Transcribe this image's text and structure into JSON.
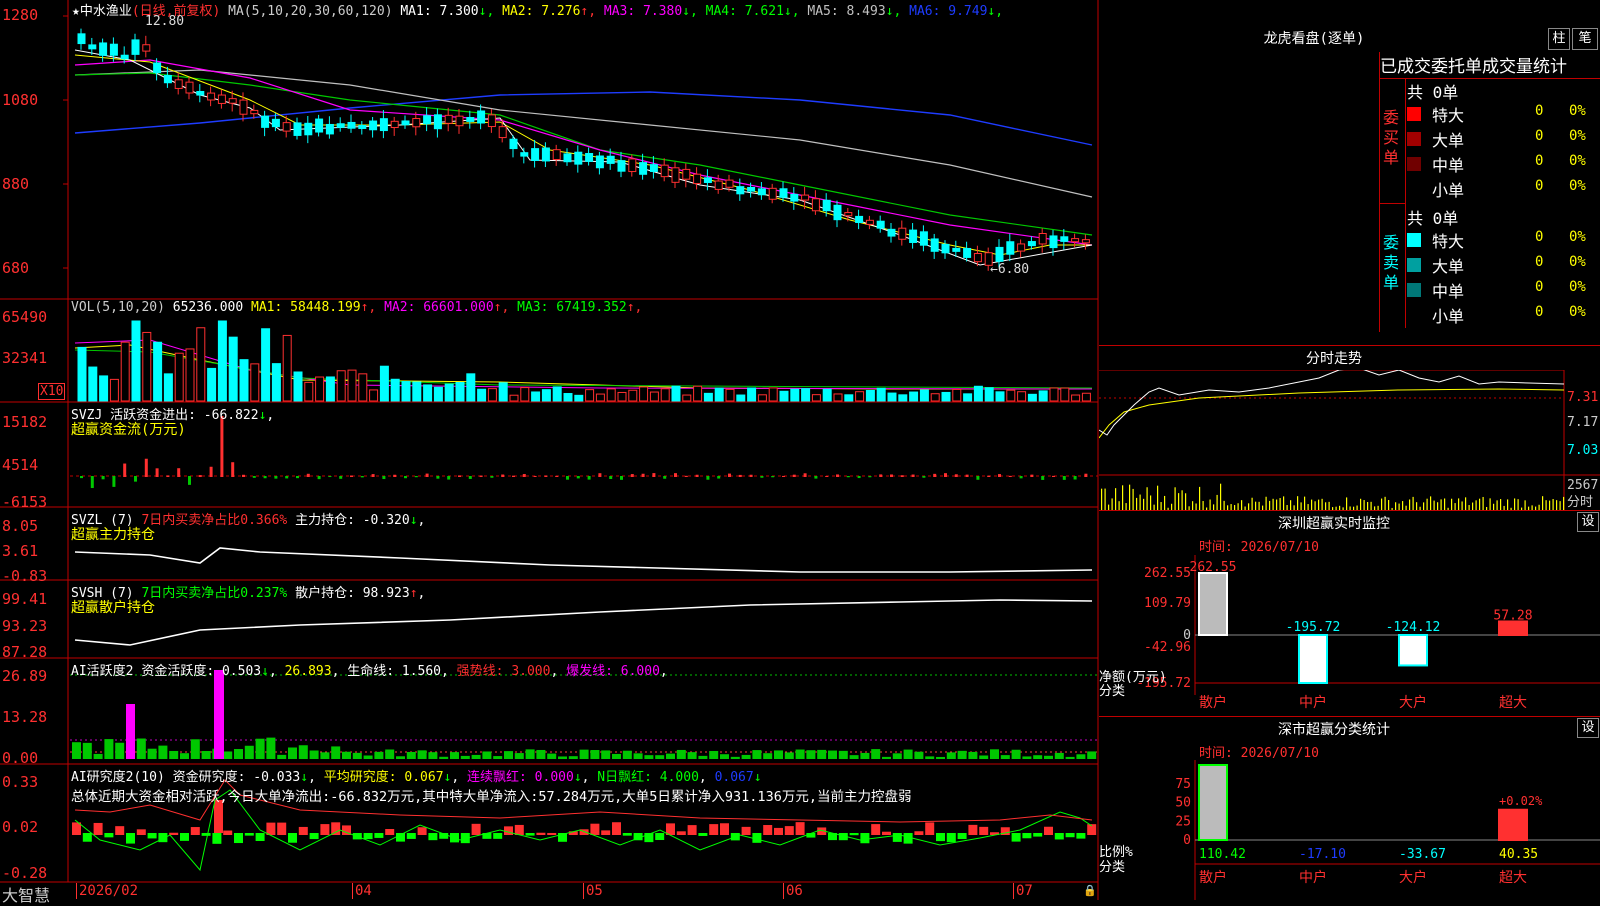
{
  "main": {
    "star": "★",
    "stock": "中水渔业",
    "period": "(日线,前复权)",
    "ma_formula": "MA(5,10,20,30,60,120)",
    "ma_values": [
      {
        "label": "MA1:",
        "value": "7.300",
        "arrow": "↓",
        "color": "#ffffff"
      },
      {
        "label": "MA2:",
        "value": "7.276",
        "arrow": "↑",
        "color": "#ffff00"
      },
      {
        "label": "MA3:",
        "value": "7.380",
        "arrow": "↓",
        "color": "#ff00ff"
      },
      {
        "label": "MA4:",
        "value": "7.621",
        "arrow": "↓",
        "color": "#00ff00"
      },
      {
        "label": "MA5:",
        "value": "8.493",
        "arrow": "↓",
        "color": "#c0c0c0"
      },
      {
        "label": "MA6:",
        "value": "9.749",
        "arrow": "↓",
        "color": "#1e3cff"
      }
    ],
    "y_ticks": [
      "1280",
      "1080",
      "880",
      "680"
    ],
    "high_label": "12.80",
    "low_label": "←6.80"
  },
  "vol": {
    "formula": "VOL(5,10,20)",
    "value": "65236.000",
    "ma_values": [
      {
        "label": "MA1:",
        "value": "58448.199",
        "arrow": "↑",
        "color": "#ffff00"
      },
      {
        "label": "MA2:",
        "value": "66601.000",
        "arrow": "↑",
        "color": "#ff00ff"
      },
      {
        "label": "MA3:",
        "value": "67419.352",
        "arrow": "↑",
        "color": "#00ff00"
      }
    ],
    "y_ticks": [
      "65490",
      "32341"
    ],
    "unit": "X10"
  },
  "svzj": {
    "title": "SVZJ",
    "label": "活跃资金进出:",
    "value": "-66.822",
    "arrow": "↓",
    "subtitle": "超赢资金流(万元)",
    "y_ticks": [
      "15182",
      "4514",
      "-6153"
    ]
  },
  "svzl": {
    "title": "SVZL (7)",
    "desc": "7日内买卖净占比0.366%",
    "label": "主力持仓:",
    "value": "-0.320",
    "arrow": "↓",
    "subtitle": "超赢主力持仓",
    "y_ticks": [
      "8.05",
      "3.61",
      "-0.83"
    ]
  },
  "svsh": {
    "title": "SVSH (7)",
    "desc": "7日内买卖净占比0.237%",
    "label": "散户持仓:",
    "value": "98.923",
    "arrow": "↑",
    "subtitle": "超赢散户持仓",
    "y_ticks": [
      "99.41",
      "93.23",
      "87.28"
    ]
  },
  "ai_active": {
    "title": "AI活跃度2",
    "label": "资金活跃度:",
    "value": "0.503",
    "arrow": "↓",
    "v2": "26.893",
    "life": "生命线: 1.560",
    "strong": "强势线: 3.000",
    "burst": "爆发线: 6.000",
    "y_ticks": [
      "26.89",
      "13.28",
      "0.00"
    ]
  },
  "ai_research": {
    "title": "AI研究度2(10)",
    "label": "资金研究度:",
    "value": "-0.033",
    "avg": "平均研究度: 0.067",
    "cont": "连续飘红: 0.000",
    "nday": "N日飘红: 4.000",
    "last": "0.067",
    "summary": "总体近期大资金相对活跃,今日大单净流出:-66.832万元,其中特大单净流入:57.284万元,大单5日累计净入931.136万元,当前主力控盘弱",
    "y_ticks": [
      "0.33",
      "0.02",
      "-0.28"
    ]
  },
  "dates": [
    "2026/02",
    "04",
    "05",
    "06",
    "07"
  ],
  "brand": "大智慧",
  "right": {
    "lhb_title": "龙虎看盘(逐单)",
    "btn_zhu": "柱",
    "btn_bi": "笔",
    "tabs": [
      "已成交",
      "委托单",
      "成交量统计"
    ],
    "buy": {
      "total": "共 0单",
      "side": "委买单",
      "rows": [
        {
          "name": "特大",
          "count": "0",
          "pct": "0%",
          "color": "#ff0000"
        },
        {
          "name": "大单",
          "count": "0",
          "pct": "0%",
          "color": "#a00000"
        },
        {
          "name": "中单",
          "count": "0",
          "pct": "0%",
          "color": "#700000"
        },
        {
          "name": "小单",
          "count": "0",
          "pct": "0%",
          "color": ""
        }
      ]
    },
    "sell": {
      "total": "共 0单",
      "side": "委卖单",
      "rows": [
        {
          "name": "特大",
          "count": "0",
          "pct": "0%",
          "color": "#00ffff"
        },
        {
          "name": "大单",
          "count": "0",
          "pct": "0%",
          "color": "#00a0a0"
        },
        {
          "name": "中单",
          "count": "0",
          "pct": "0%",
          "color": "#007878"
        },
        {
          "name": "小单",
          "count": "0",
          "pct": "0%",
          "color": ""
        }
      ]
    },
    "intraday": {
      "title": "分时走势",
      "y_ticks": [
        "7.31",
        "7.17",
        "7.03"
      ],
      "vol_tick": "2567",
      "vol_label": "分时"
    },
    "sz_monitor": {
      "title": "深圳超赢实时监控",
      "set": "设",
      "time": "时间: 2026/07/10",
      "y_ticks": [
        "262.55",
        "109.79",
        "0",
        "-42.96",
        "-195.72"
      ],
      "axis_label": "净额(万元)",
      "cat_label": "分类"
    },
    "sz_class": {
      "title": "深市超赢分类统计",
      "set": "设",
      "time": "时间: 2026/07/10",
      "y_ticks": [
        "75",
        "50",
        "25",
        "0"
      ],
      "axis_label": "比例%",
      "cat_label": "分类",
      "pct_label": "+0.02%"
    }
  },
  "chart_data": [
    {
      "type": "bar",
      "title": "深圳超赢实时监控",
      "categories": [
        "散户",
        "中户",
        "大户",
        "超大"
      ],
      "values": [
        262.55,
        -195.72,
        -124.12,
        57.28
      ],
      "ylim": [
        -195.72,
        262.55
      ],
      "ylabel": "净额(万元)"
    },
    {
      "type": "bar",
      "title": "深市超赢分类统计",
      "categories": [
        "散户",
        "中户",
        "大户",
        "超大"
      ],
      "values": [
        110.42,
        -17.1,
        -33.67,
        40.35
      ],
      "ylim": [
        0,
        100
      ],
      "ylabel": "比例%"
    },
    {
      "type": "line",
      "title": "中水渔业 (日线,前复权)",
      "y_axis": [
        6.8,
        12.8
      ],
      "series": [
        {
          "name": "MA6",
          "values": [
            11.0,
            10.6,
            10.4,
            10.0,
            9.4,
            8.8
          ]
        }
      ]
    }
  ]
}
